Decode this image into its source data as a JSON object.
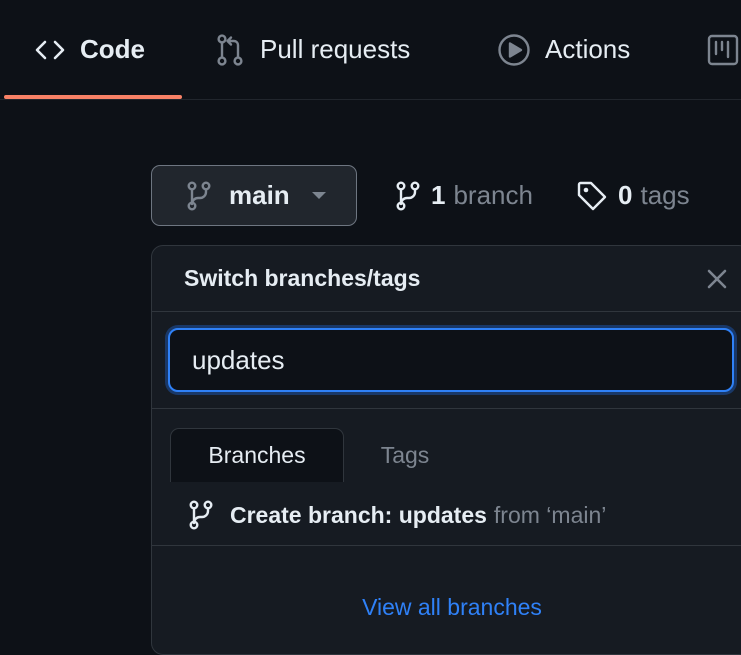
{
  "nav": {
    "tabs": [
      {
        "label": "Code",
        "icon": "code-icon",
        "active": true
      },
      {
        "label": "Pull requests",
        "icon": "git-pull-request-icon",
        "active": false
      },
      {
        "label": "Actions",
        "icon": "play-icon",
        "active": false
      },
      {
        "label": "",
        "icon": "project-board-icon",
        "active": false
      }
    ],
    "active_color": "#f78166"
  },
  "branch_selector": {
    "current": "main",
    "icon": "git-branch-icon"
  },
  "meta": {
    "branches_count": "1",
    "branches_label": "branch",
    "tags_count": "0",
    "tags_label": "tags"
  },
  "dropdown": {
    "title": "Switch branches/tags",
    "search_value": "updates",
    "tabs": [
      "Branches",
      "Tags"
    ],
    "create_prefix": "Create branch: updates",
    "create_suffix": "from ‘main’",
    "view_all": "View all branches",
    "link_color": "#2f81f7",
    "focus_color": "#2f81f7"
  }
}
